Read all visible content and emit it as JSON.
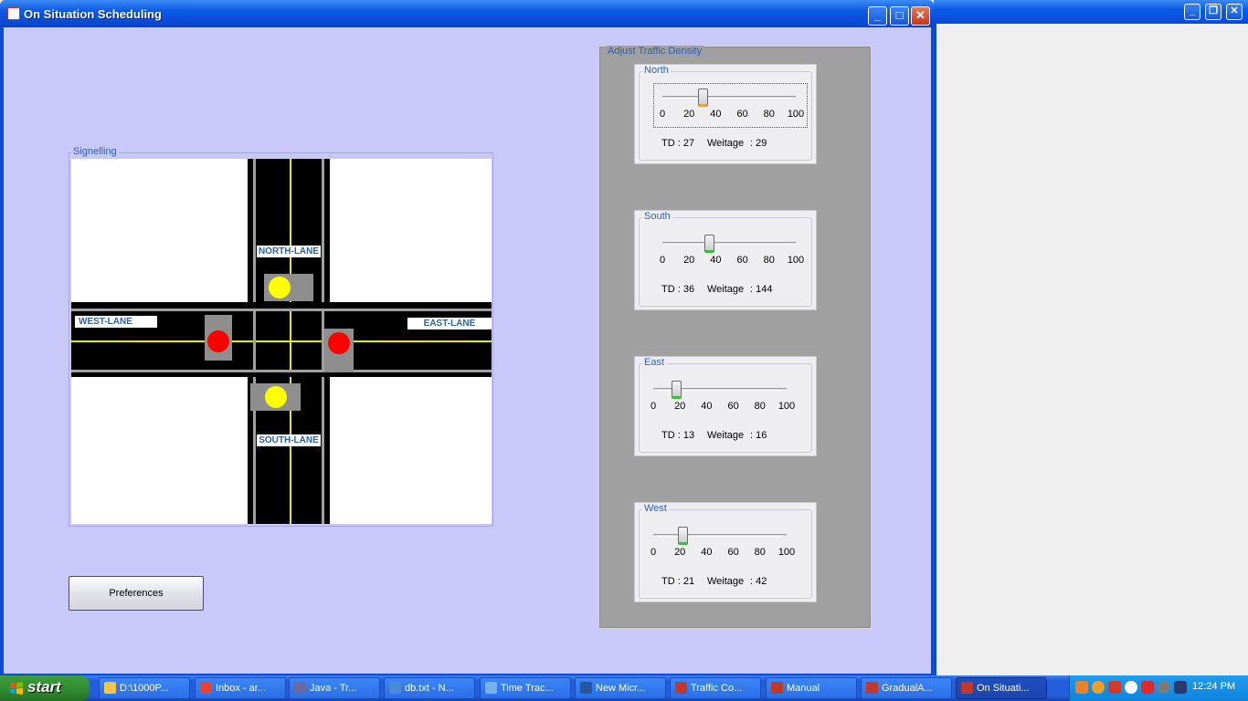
{
  "window": {
    "title": "On Situation Scheduling"
  },
  "signalling": {
    "legend": "Signelling",
    "lanes": {
      "north": "NORTH-LANE",
      "south": "SOUTH-LANE",
      "east": "EAST-LANE",
      "west": "WEST-LANE"
    },
    "lights": {
      "north": "yellow",
      "south": "yellow",
      "east": "red",
      "west": "red"
    }
  },
  "density": {
    "legend": "Adjust Traffic Density",
    "ticks": [
      "0",
      "20",
      "40",
      "60",
      "80",
      "100"
    ],
    "directions": [
      {
        "name": "North",
        "value": 30,
        "td_label": "TD : 27",
        "weight_label": "Weitage",
        "weight_value": ": 29",
        "indicator": "orange"
      },
      {
        "name": "South",
        "value": 35,
        "td_label": "TD : 36",
        "weight_label": "Weitage",
        "weight_value": ": 144",
        "indicator": "green"
      },
      {
        "name": "East",
        "value": 17,
        "td_label": "TD : 13",
        "weight_label": "Weitage",
        "weight_value": ": 16",
        "indicator": "green"
      },
      {
        "name": "West",
        "value": 22,
        "td_label": "TD : 21",
        "weight_label": "Weitage",
        "weight_value": ": 42",
        "indicator": "green"
      }
    ]
  },
  "buttons": {
    "preferences": "Preferences"
  },
  "taskbar": {
    "start": "start",
    "items": [
      "D:\\1000P...",
      "Inbox - ar...",
      "Java - Tr...",
      "db.txt - N...",
      "Time Trac...",
      "New Micr...",
      "Traffic Co...",
      "Manual",
      "GradualA...",
      "On Situati..."
    ],
    "clock": "12:24 PM"
  },
  "colors": {
    "client_bg": "#c8c8fa",
    "panel_bg": "#a0a0a0",
    "light_red": "#ff0000",
    "light_yellow": "#ffff00"
  }
}
